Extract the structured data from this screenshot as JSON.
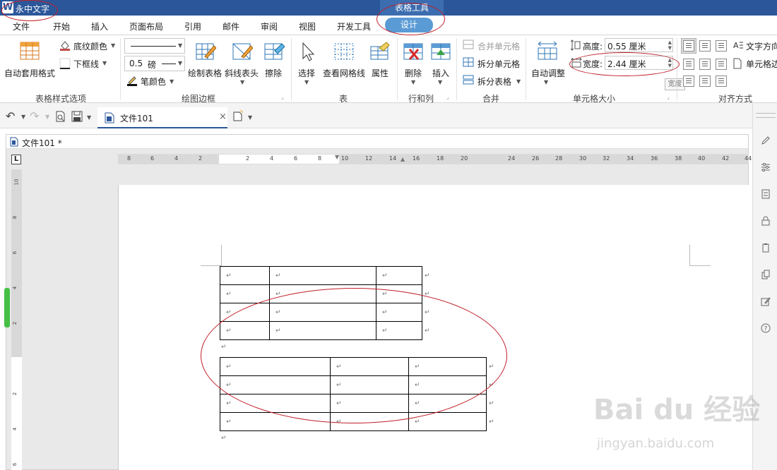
{
  "titlebar": {
    "app_title": "永中文字",
    "logo_letter": "W",
    "contextual_group": "表格工具"
  },
  "tabs": [
    "文件",
    "开始",
    "插入",
    "页面布局",
    "引用",
    "邮件",
    "审阅",
    "视图",
    "开发工具",
    "设计"
  ],
  "active_tab": "设计",
  "ribbon": {
    "auto_format": "自动套用格式",
    "shading_color": "底纹颜色",
    "bottom_border": "下框线",
    "line_weight_value": "0.5",
    "line_weight_unit": "磅",
    "pen_color": "笔颜色",
    "draw_table": "绘制表格",
    "diagonal_header": "斜线表头",
    "erase": "擦除",
    "select": "选择",
    "view_gridlines": "查看网格线",
    "properties": "属性",
    "delete": "删除",
    "insert": "插入",
    "merge_cells": "合并单元格",
    "split_cells": "拆分单元格",
    "split_table": "拆分表格",
    "autofit": "自动调整",
    "height_label": "高度:",
    "height_value": "0.55 厘米",
    "width_label": "宽度:",
    "width_value": "2.44 厘米",
    "width_tooltip": "宽度",
    "text_direction": "文字方向",
    "cell_margins": "单元格边",
    "groups": {
      "table_style_options": "表格样式选项",
      "draw_borders": "绘图边框",
      "table": "表",
      "rows_columns": "行和列",
      "merge": "合并",
      "cell_size": "单元格大小",
      "alignment": "对齐方式"
    }
  },
  "document": {
    "tab_name": "文件101",
    "window_title": "文件101 *"
  },
  "ruler": {
    "h_ticks": [
      "8",
      "6",
      "4",
      "2",
      "2",
      "4",
      "6",
      "8",
      "10",
      "12",
      "14",
      "16",
      "18",
      "20",
      "24",
      "26",
      "28",
      "30",
      "32",
      "34",
      "36",
      "38",
      "40",
      "42",
      "44"
    ],
    "v_ticks": [
      "10",
      "8",
      "6",
      "4",
      "2",
      "2",
      "4",
      "6"
    ]
  },
  "paragraph_mark": "↵",
  "watermark": {
    "brand": "Bai du 经验",
    "url": "jingyan.baidu.com"
  },
  "colors": {
    "titlebar": "#2b579a",
    "active_tab": "#5b9bd5",
    "annotation": "#c0202a"
  }
}
